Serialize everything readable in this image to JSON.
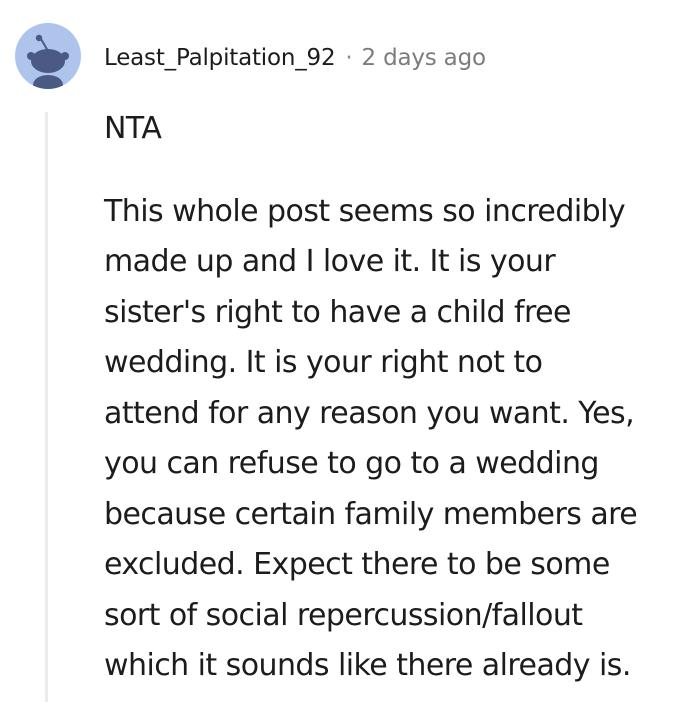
{
  "comment": {
    "username": "Least_Palpitation_92",
    "separator": "·",
    "timestamp": "2 days ago",
    "avatar_icon": "snoo-avatar-icon",
    "body": {
      "verdict": "NTA",
      "lines": [
        "This whole post seems so incredibly",
        "made up and I love it. It is your",
        "sister's right to have a child free",
        "wedding. It is your right not to",
        "attend for any reason you want. Yes,",
        "you can refuse to go to a wedding",
        "because certain family members are",
        "excluded. Expect there to be some",
        "sort of social repercussion/fallout",
        "which it sounds like there already is."
      ]
    }
  },
  "colors": {
    "avatar_bg": "#aec4ec",
    "avatar_fg": "#4a5a82",
    "text": "#1c1c1c",
    "muted": "#7c7c7c",
    "thread_line": "#ececec"
  }
}
